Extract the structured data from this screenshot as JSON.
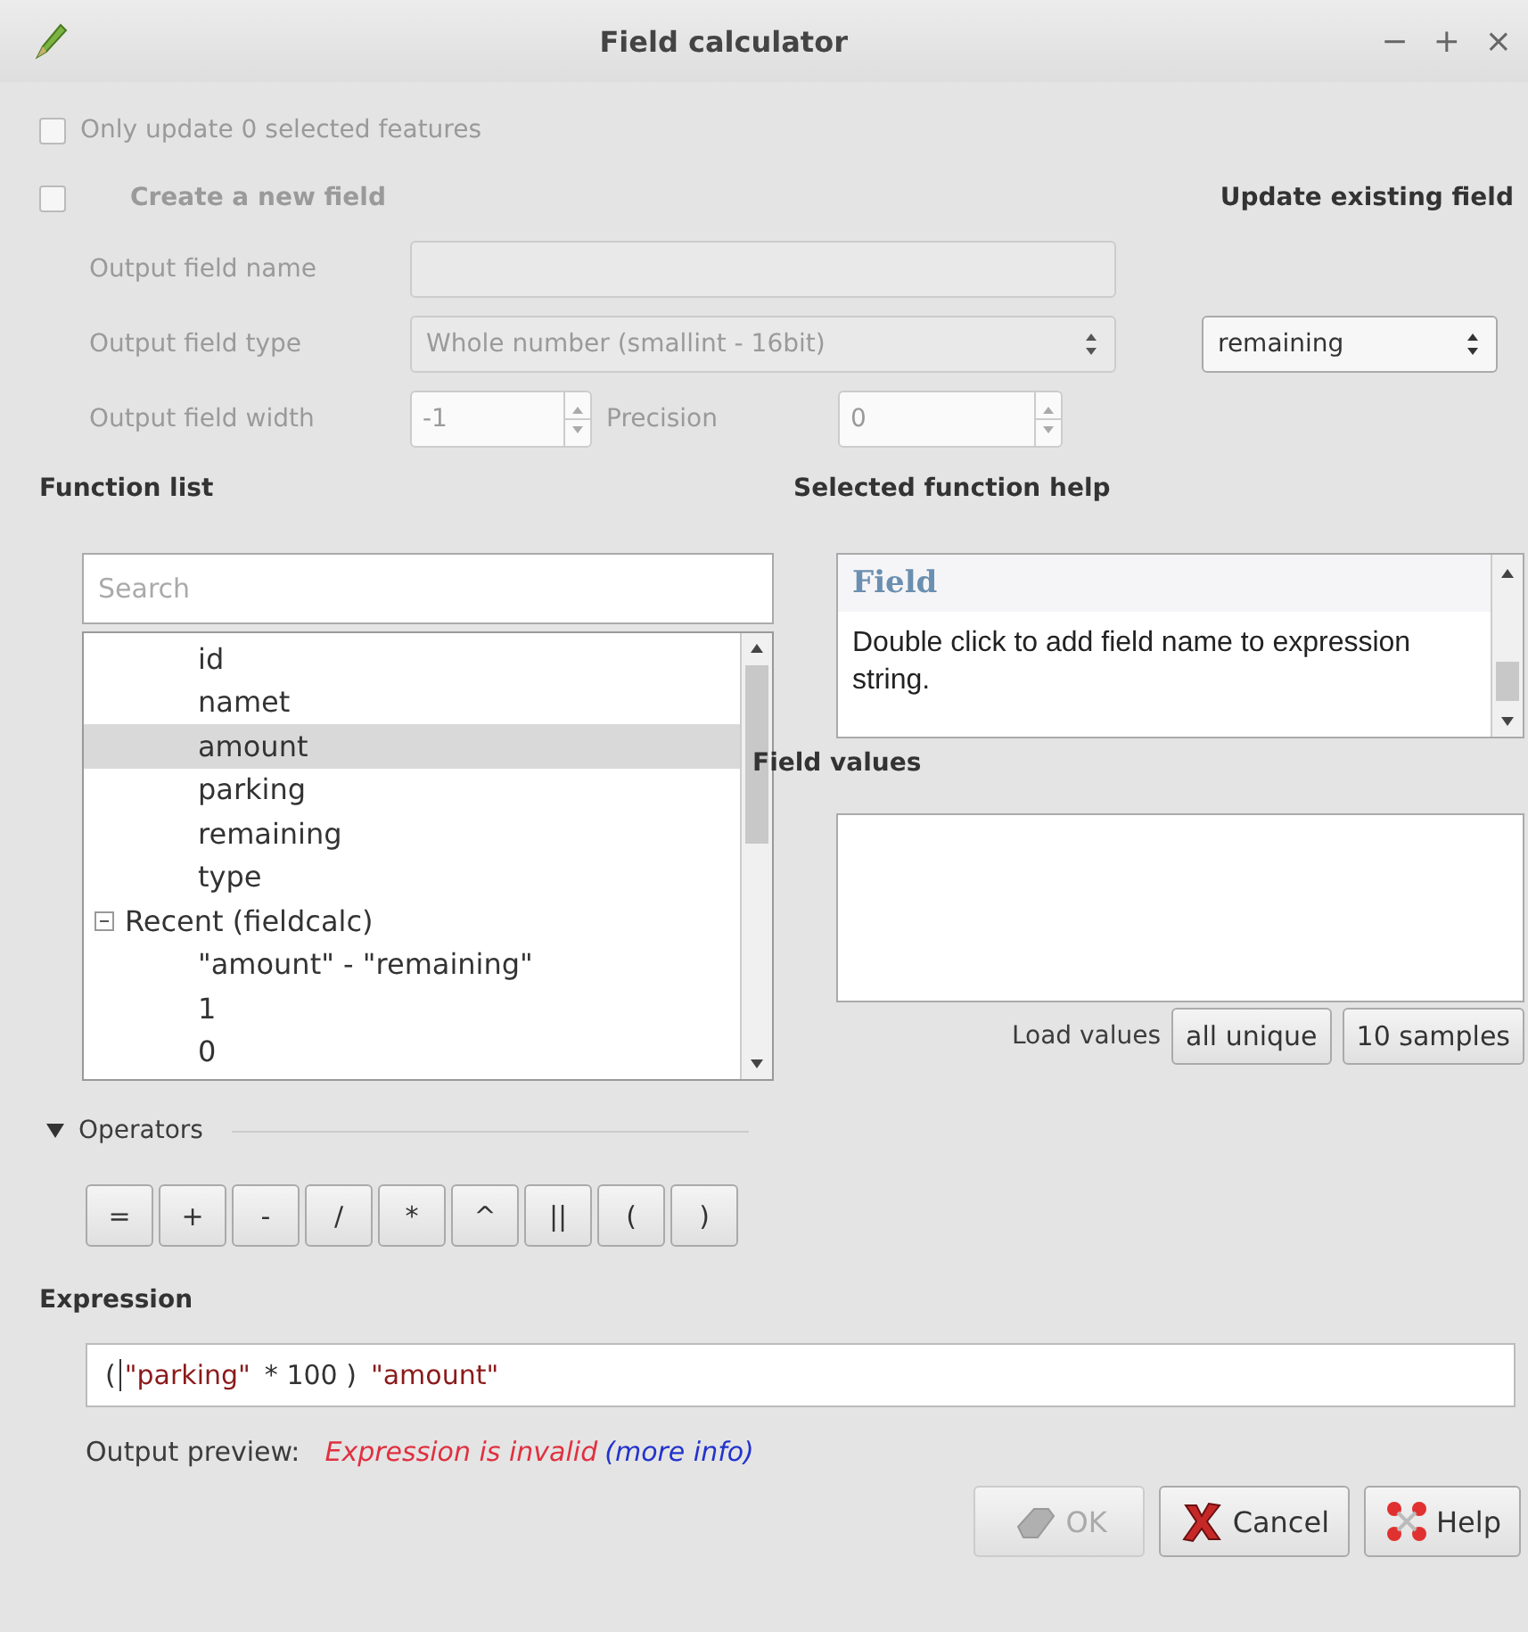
{
  "window": {
    "title": "Field calculator",
    "controls": [
      "−",
      "+",
      "×"
    ]
  },
  "only_update": {
    "label": "Only update 0 selected features",
    "checked": false,
    "disabled": true
  },
  "new_field": {
    "label": "Create a new field",
    "checked": false,
    "disabled": true,
    "name_label": "Output field name",
    "type_label": "Output field type",
    "type_value": "Whole number (smallint - 16bit)",
    "width_label": "Output field width",
    "width_value": "-1",
    "precision_label": "Precision",
    "precision_value": "0"
  },
  "existing_field": {
    "label": "Update existing field",
    "value": "remaining"
  },
  "function_list": {
    "heading": "Function list",
    "search": {
      "placeholder": "Search"
    },
    "tree": [
      {
        "children": [
          {
            "label": "id",
            "selected": false
          },
          {
            "label": "namet",
            "selected": false
          },
          {
            "label": "amount",
            "selected": true
          },
          {
            "label": "parking",
            "selected": false
          },
          {
            "label": "remaining",
            "selected": false
          },
          {
            "label": "type",
            "selected": false
          }
        ]
      },
      {
        "label": "Recent (fieldcalc)",
        "expanded": true,
        "selected": false,
        "children": [
          {
            "label": "\"amount\"  -  \"remaining\"",
            "selected": false
          },
          {
            "label": "1",
            "selected": false
          },
          {
            "label": "0",
            "selected": false
          }
        ]
      }
    ]
  },
  "function_help": {
    "heading": "Selected function help",
    "title": "Field",
    "text": "Double click to add field name to expression string."
  },
  "field_values": {
    "heading": "Field values",
    "load_label": "Load values",
    "buttons": [
      "all unique",
      "10 samples"
    ]
  },
  "operators": {
    "label": "Operators",
    "expanded": true,
    "buttons": [
      "=",
      "+",
      "-",
      "/",
      "*",
      "^",
      "||",
      "(",
      ")"
    ]
  },
  "expression": {
    "heading": "Expression",
    "tokens": [
      {
        "text": "(",
        "kind": "plain"
      },
      {
        "text": "\"parking\"",
        "kind": "field"
      },
      {
        "text": "* 100 )",
        "kind": "plain"
      },
      {
        "text": "\"amount\"",
        "kind": "field"
      }
    ]
  },
  "output_preview": {
    "label": "Output preview:",
    "error": "Expression is invalid",
    "link": "(more info)"
  },
  "buttons": [
    {
      "label": "OK",
      "kind": "ok",
      "disabled": true
    },
    {
      "label": "Cancel",
      "kind": "cancel",
      "disabled": false
    },
    {
      "label": "Help",
      "kind": "help",
      "disabled": false
    }
  ]
}
